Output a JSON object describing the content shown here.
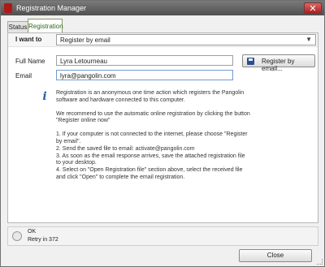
{
  "window": {
    "title": "Registration Manager",
    "close_glyph": "✕"
  },
  "tabs": [
    {
      "label": "Status"
    },
    {
      "label": "Registration"
    }
  ],
  "form": {
    "iwant_label": "I want to",
    "iwant_value": "Register by email",
    "dropdown_glyph": "▼",
    "fullname_label": "Full Name",
    "fullname_value": "Lyra Letourneau",
    "email_label": "Email",
    "email_value": "lyra@pangolin.com",
    "register_button": "Register by email..."
  },
  "info": {
    "icon_glyph": "i",
    "paragraphs": [
      "Registration is an anonymous one time action which registers the Pangolin software and hardware connected to this computer.",
      "We recommend to use the automatic online registration by clicking the button \"Register online now\"",
      "1. If your computer is not connected to the internet, please choose \"Register by email\".\n2. Send the saved file to email: activate@pangolin.com\n3. As soon as the email response arrives, save the attached registration file to your desktop.\n4. Select on \"Open Registration file\" section above, select the received file and click \"Open\" to complete the email registration."
    ]
  },
  "status": {
    "state": "OK",
    "retry": "Retry in 372"
  },
  "footer": {
    "close_label": "Close"
  },
  "colors": {
    "accent": "#2d5fae",
    "tab_active_text": "#2b6a1f"
  }
}
